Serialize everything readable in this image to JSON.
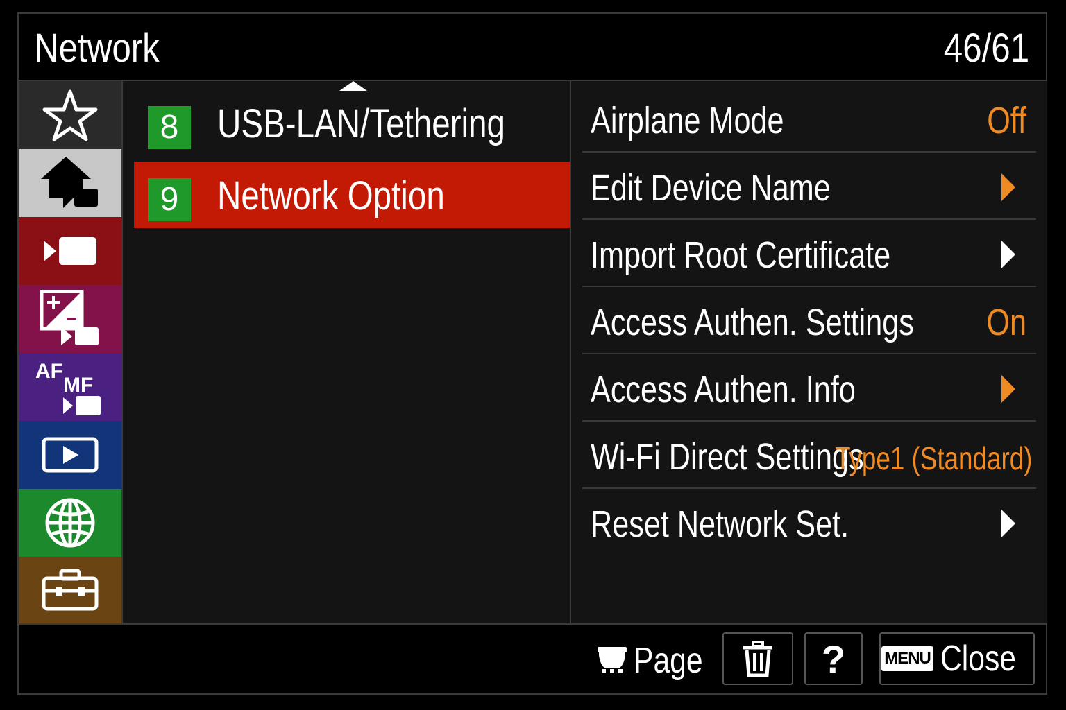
{
  "header": {
    "title": "Network",
    "page_count": "46/61"
  },
  "sidebar": {
    "tabs": [
      {
        "icon": "star-icon",
        "bg": "#2a2a2a"
      },
      {
        "icon": "home-camera-icon",
        "bg": "#c8c8c8",
        "selected": true
      },
      {
        "icon": "shooting-icon",
        "bg": "#8a1016"
      },
      {
        "icon": "exposure-color-icon",
        "bg": "#84124a"
      },
      {
        "icon": "af-mf-icon",
        "bg": "#4a2080"
      },
      {
        "icon": "playback-icon",
        "bg": "#12357a"
      },
      {
        "icon": "network-globe-icon",
        "bg": "#1c8a2c"
      },
      {
        "icon": "setup-toolbox-icon",
        "bg": "#6a4412"
      }
    ]
  },
  "middle": {
    "items": [
      {
        "num": "8",
        "label": "USB-LAN/Tethering",
        "selected": false
      },
      {
        "num": "9",
        "label": "Network Option",
        "selected": true
      }
    ]
  },
  "right": {
    "items": [
      {
        "label": "Airplane Mode",
        "value": "Off",
        "kind": "value"
      },
      {
        "label": "Edit Device Name",
        "value": "",
        "kind": "arrow-orange"
      },
      {
        "label": "Import Root Certificate",
        "value": "",
        "kind": "arrow"
      },
      {
        "label": "Access Authen. Settings",
        "value": "On",
        "kind": "value"
      },
      {
        "label": "Access Authen. Info",
        "value": "",
        "kind": "arrow-orange"
      },
      {
        "label": "Wi-Fi Direct Settings",
        "value": "Type1 (Standard)",
        "kind": "value"
      },
      {
        "label": "Reset Network Set.",
        "value": "",
        "kind": "arrow"
      }
    ]
  },
  "footer": {
    "page_label": "Page",
    "help_label": "?",
    "menu_badge": "MENU",
    "close_label": "Close"
  },
  "colors": {
    "accent_value": "#f08a22",
    "selected_bg": "#c21a05",
    "number_badge": "#1f9a2a"
  }
}
